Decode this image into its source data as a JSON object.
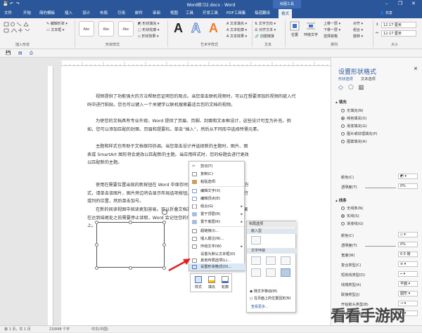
{
  "window": {
    "title": "Word练习2.docx - Word",
    "context_tab": "绘图工具"
  },
  "tabs": [
    "文件",
    "开始",
    "简的模板",
    "插入",
    "设计",
    "布局",
    "引用",
    "邮件",
    "审阅",
    "视图",
    "工具",
    "开发工具",
    "PDF工具集",
    "每道翻译",
    "格式"
  ],
  "ribbon": {
    "shape_styles": [
      "Abc",
      "Abc",
      "Abc"
    ],
    "wordart_letters": [
      "A",
      "A",
      "A"
    ],
    "group_labels": [
      "插入形状",
      "形状样式",
      "艺术字样式",
      "文本",
      "排列",
      "大小"
    ],
    "size_height": "12.17 厘米",
    "size_width": "12.17 厘米",
    "position_label": "位置",
    "wrap_label": "环绕文字"
  },
  "document": {
    "paragraphs": [
      "视频提供了功能强大的方法帮助您证明您的观点。当您单击联机视频时，可以在想要添加的视频的嵌入代码中进行粘贴。您也可以键入一个关键字以联机搜索最适合您的文档的视频。",
      "为使您的文档具有专业外观，Word 提供了页眉、页脚、封面和文本框设计，这些设计可互为补充。例如，您可以添加匹配的封面、页眉和提要栏。单击“插入”，然后从不同库中选择所需元素。",
      "主题和样式也有助于文档保持协调。当您单击设计并选择新的主题时，图片、图表或 SmartArt 图形将会更改以匹配新的主题。当应用样式时，您的标题会进行更改以匹配新的主题。",
      "使用在需要位置出现的新按钮在 Word 中保存时间。若要更改图片适应文档的方式，请单击该图片，图片旁边将会显示布局选项按钮。当处理表格时，单击要添加行或列的位置，然后单击加号。",
      "在新的阅读视图中阅读更加容易。可以折叠文档某些部分并关注所需文本。如果在达到结尾处之前需要停止读取，Word 会记住您的停止位置 - 即使在另一个设备上。"
    ]
  },
  "context_menu": {
    "items": [
      "剪切(T)",
      "复制(C)",
      "粘贴选项:",
      "编辑文字(X)",
      "编辑顶点(E)",
      "组合(G)",
      "置于顶层(R)",
      "置于底层(K)",
      "超链接(I)...",
      "插入题注(N)...",
      "环绕文字(W)",
      "设置为默认文本框(D)",
      "其他布局选项(L)...",
      "设置形状格式(O)..."
    ],
    "highlighted_index": 13
  },
  "mini_toolbar": {
    "items": [
      "样式",
      "填充",
      "轮廓"
    ]
  },
  "layout_popup": {
    "header": "布局选项",
    "section1": "嵌入型",
    "section2": "文字环绕",
    "radio1": "随文字移动(M)",
    "radio2": "在页面上的位置固定(N)",
    "link": "查看更多..."
  },
  "pane": {
    "title": "设置形状格式",
    "tabs": [
      "形状选项",
      "文本选项"
    ],
    "fill_section": "填充",
    "fill_options": [
      "无填充(N)",
      "纯色填充(S)",
      "渐变填充(G)",
      "图片或纹理填充(P)",
      "图案填充(A)"
    ],
    "fill_color_label": "颜色(C)",
    "fill_transparency_label": "透明度(T)",
    "fill_transparency_value": "0%",
    "line_section": "线条",
    "line_options": [
      "无线条(N)",
      "实线(S)",
      "渐变线(G)"
    ],
    "line_color_label": "颜色(C)",
    "line_transparency_label": "透明度(T)",
    "line_transparency_value": "0%",
    "width_label": "宽度(W)",
    "width_value": "0.5 磅",
    "compound_label": "复合类型(C)",
    "dash_label": "短划线类型(D)",
    "cap_label": "线端类型(A)",
    "cap_value": "平面",
    "join_label": "联接类型(J)",
    "join_value": "圆形",
    "begin_arrow_label": "开始箭头类型(B)",
    "begin_size_label": "开始箭头粗细(S)",
    "end_arrow_label": "结尾箭头类型(E)",
    "end_size_label": "结尾箭头粗细(N)"
  },
  "status": {
    "left": "第 1 页，共 1 页",
    "words": "23/848 个字",
    "lang": "中文(中国)"
  },
  "watermark": "看看手游网"
}
